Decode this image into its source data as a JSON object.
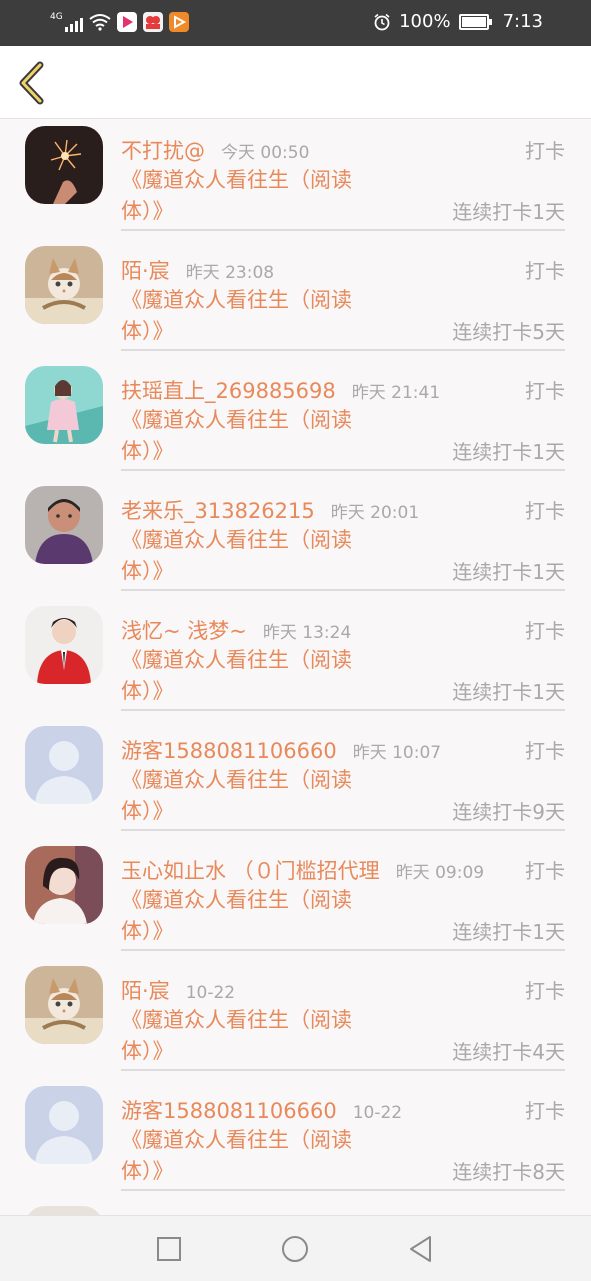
{
  "status_bar": {
    "network": "4G",
    "battery": "100%",
    "time": "7:13"
  },
  "colors": {
    "accent": "#e8895a",
    "muted": "#a9a9a9",
    "background": "#f9f7f8"
  },
  "items": [
    {
      "name": "不打扰@",
      "time": "今天 00:50",
      "tag": "打卡",
      "book": "《魔道众人看往生（阅读体）》",
      "streak": "连续打卡1天",
      "avatar": "sparkler"
    },
    {
      "name": "陌·宸",
      "time": "昨天 23:08",
      "tag": "打卡",
      "book": "《魔道众人看往生（阅读体）》",
      "streak": "连续打卡5天",
      "avatar": "cat"
    },
    {
      "name": "扶瑶直上_269885698",
      "time": "昨天 21:41",
      "tag": "打卡",
      "book": "《魔道众人看往生（阅读体）》",
      "streak": "连续打卡1天",
      "avatar": "girl-teal"
    },
    {
      "name": "老来乐_313826215",
      "time": "昨天 20:01",
      "tag": "打卡",
      "book": "《魔道众人看往生（阅读体）》",
      "streak": "连续打卡1天",
      "avatar": "woman-purple"
    },
    {
      "name": "浅忆~ 浅梦~",
      "time": "昨天 13:24",
      "tag": "打卡",
      "book": "《魔道众人看往生（阅读体）》",
      "streak": "连续打卡1天",
      "avatar": "man-red"
    },
    {
      "name": "游客1588081106660",
      "time": "昨天 10:07",
      "tag": "打卡",
      "book": "《魔道众人看往生（阅读体）》",
      "streak": "连续打卡9天",
      "avatar": "default"
    },
    {
      "name": "玉心如止水 （０门槛招代理",
      "time": "昨天 09:09",
      "tag": "打卡",
      "book": "《魔道众人看往生（阅读体）》",
      "streak": "连续打卡1天",
      "avatar": "woman-pink"
    },
    {
      "name": "陌·宸",
      "time": "10-22",
      "tag": "打卡",
      "book": "《魔道众人看往生（阅读体）》",
      "streak": "连续打卡4天",
      "avatar": "cat"
    },
    {
      "name": "游客1588081106660",
      "time": "10-22",
      "tag": "打卡",
      "book": "《魔道众人看往生（阅读体）》",
      "streak": "连续打卡8天",
      "avatar": "default"
    }
  ]
}
